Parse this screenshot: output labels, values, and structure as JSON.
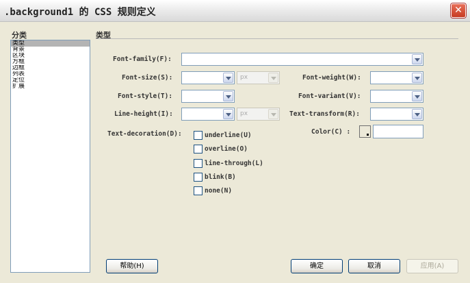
{
  "dialog": {
    "title": ".background1 的 CSS 规则定义",
    "close_glyph": "✕"
  },
  "category": {
    "header": "分类",
    "items": [
      "类型",
      "背景",
      "区块",
      "方框",
      "边框",
      "列表",
      "定位",
      "扩展"
    ],
    "selected_index": 0
  },
  "type_section": {
    "header": "类型",
    "font_family_label": "Font-family(F):",
    "font_size_label": "Font-size(S):",
    "font_size_unit": "px",
    "font_weight_label": "Font-weight(W):",
    "font_style_label": "Font-style(T):",
    "font_variant_label": "Font-variant(V):",
    "line_height_label": "Line-height(I):",
    "line_height_unit": "px",
    "text_transform_label": "Text-transform(R):",
    "text_decoration_label": "Text-decoration(D):",
    "color_label": "Color(C) :",
    "decorations": [
      "underline(U)",
      "overline(O)",
      "line-through(L)",
      "blink(B)",
      "none(N)"
    ]
  },
  "buttons": {
    "help": "帮助(H)",
    "ok": "确定",
    "cancel": "取消",
    "apply": "应用(A)"
  }
}
